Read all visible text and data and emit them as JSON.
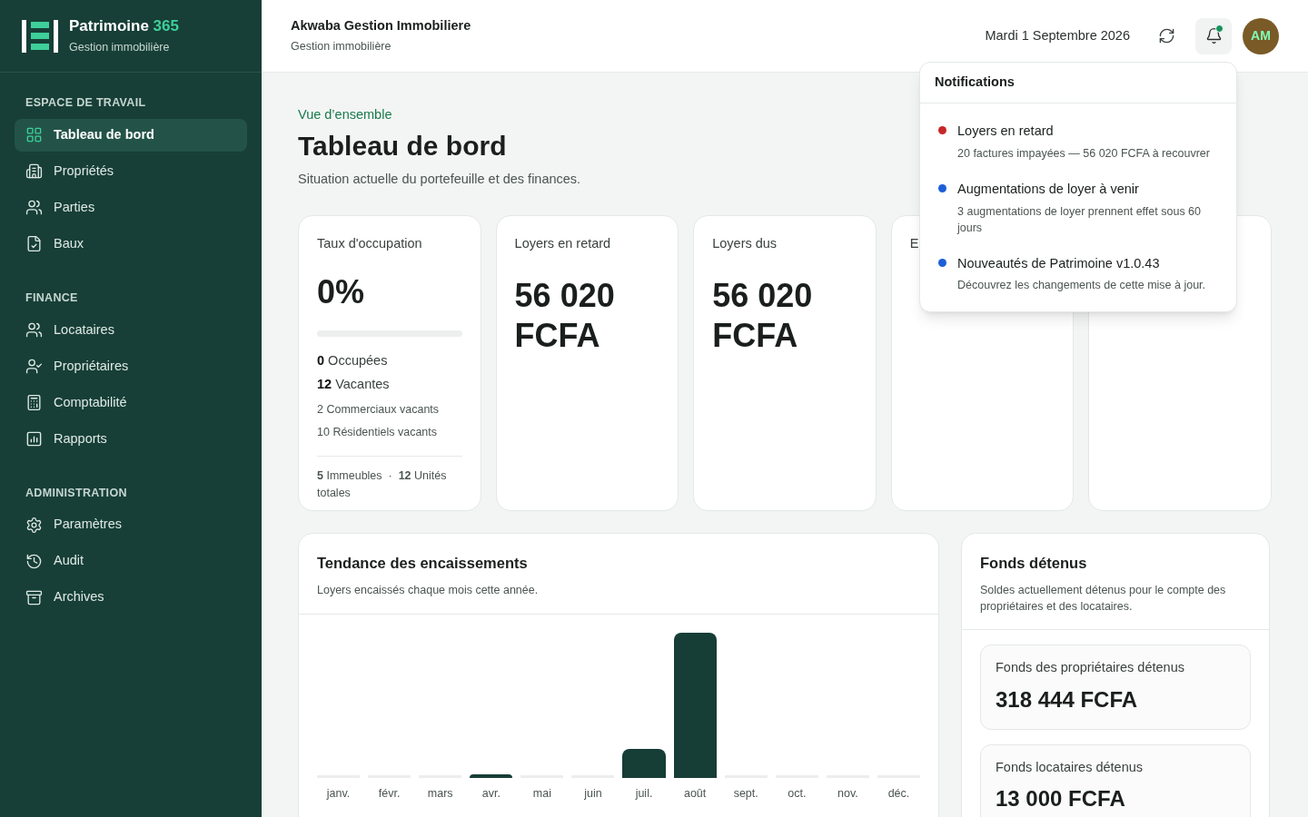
{
  "brand": {
    "name": "Patrimoine",
    "accent": "365",
    "tagline": "Gestion immobilière"
  },
  "sidebar": {
    "sections": [
      {
        "heading": "ESPACE DE TRAVAIL",
        "items": [
          {
            "label": "Tableau de bord",
            "selected": true
          },
          {
            "label": "Propriétés",
            "selected": false
          },
          {
            "label": "Parties",
            "selected": false
          },
          {
            "label": "Baux",
            "selected": false
          }
        ]
      },
      {
        "heading": "FINANCE",
        "items": [
          {
            "label": "Locataires",
            "selected": false
          },
          {
            "label": "Propriétaires",
            "selected": false
          },
          {
            "label": "Comptabilité",
            "selected": false
          },
          {
            "label": "Rapports",
            "selected": false
          }
        ]
      },
      {
        "heading": "ADMINISTRATION",
        "items": [
          {
            "label": "Paramètres",
            "selected": false
          },
          {
            "label": "Audit",
            "selected": false
          },
          {
            "label": "Archives",
            "selected": false
          }
        ]
      }
    ]
  },
  "header": {
    "company": "Akwaba Gestion Immobiliere",
    "subtitle": "Gestion immobilière",
    "date": "Mardi 1 Septembre 2026",
    "avatar": "AM",
    "unread": true
  },
  "page": {
    "eyebrow": "Vue d’ensemble",
    "title": "Tableau de bord",
    "subtitle": "Situation actuelle du portefeuille et des finances."
  },
  "occupancy": {
    "title": "Taux d'occupation",
    "value": "0%",
    "level": 0,
    "lines": [
      "**0** Occupées",
      "**12** Vacantes"
    ],
    "details": [
      "2 Commerciaux vacants",
      "10 Résidentiels vacants"
    ],
    "footer": "**5** Immeubles  ·  **12** Unités totales"
  },
  "stat_cards": [
    {
      "title": "Loyers en retard",
      "value": "56 020 FCFA"
    },
    {
      "title": "Loyers dus",
      "value": "56 020 FCFA"
    },
    {
      "title": "E"
    }
  ],
  "chart": {
    "title": "Tendance des encaissements",
    "subtitle": "Loyers encaissés chaque mois cette année.",
    "months": [
      "janv.",
      "févr.",
      "mars",
      "avr.",
      "mai",
      "juin",
      "juil.",
      "août",
      "sept.",
      "oct.",
      "nov.",
      "déc."
    ]
  },
  "funds": {
    "title": "Fonds détenus",
    "subtitle": "Soldes actuellement détenus pour le compte des propriétaires et des locataires.",
    "items": [
      {
        "label": "Fonds des propriétaires détenus",
        "value": "318 444 FCFA"
      },
      {
        "label": "Fonds locataires détenus",
        "value": "13 000 FCFA"
      }
    ]
  },
  "notifications": {
    "title": "Notifications",
    "items": [
      {
        "title": "Loyers en retard",
        "body": "20 factures impayées — 56 020 FCFA à recouvrer",
        "color": "#c62828"
      },
      {
        "title": "Augmentations de loyer à venir",
        "body": "3 augmentations de loyer prennent effet sous 60 jours",
        "color": "#1d5fd6"
      },
      {
        "title": "Nouveautés de Patrimoine v1.0.43",
        "body": "Découvrez les changements de cette mise à jour.",
        "color": "#1d5fd6"
      }
    ]
  }
}
